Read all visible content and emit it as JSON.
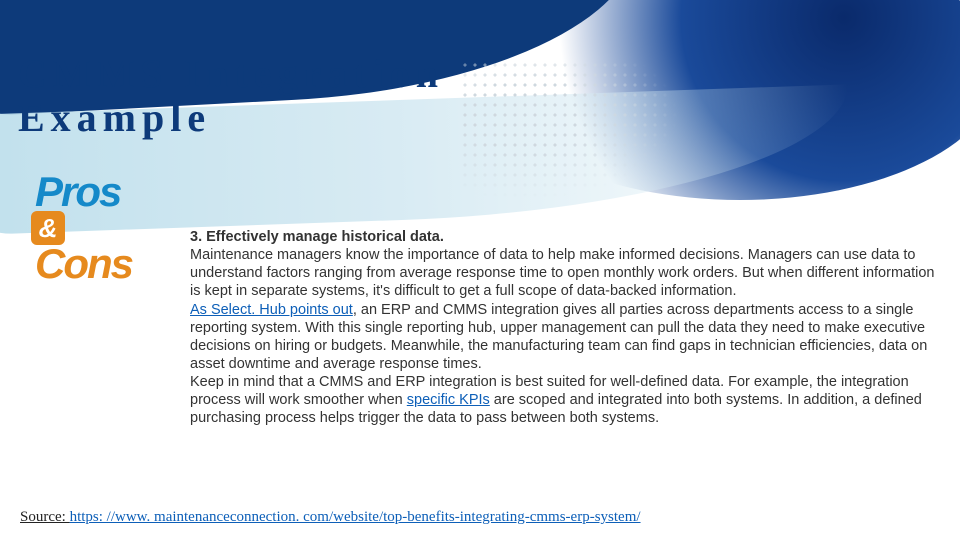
{
  "title": "CMMS Integration\nExample",
  "proscons": {
    "pros": "Pros",
    "and": "&",
    "cons": "Cons"
  },
  "item": {
    "heading": "3. Effectively manage historical data.",
    "para1": "Maintenance managers know the importance of data to help make informed decisions. Managers can use data to understand factors ranging from average response time to open monthly work orders. But when different information is kept in separate systems, it's difficult to get a full scope of data-backed information.",
    "link1_text": "As Select. Hub points out",
    "para2_after_link": ", an ERP and CMMS integration gives all parties across departments access to a single reporting system. With this single reporting hub, upper management can pull the data they need to make executive decisions on hiring or budgets. Meanwhile, the manufacturing team can find gaps in technician efficiencies, data on asset downtime and average response times.",
    "para3_before_link": "Keep in mind that a CMMS and ERP integration is best suited for well-defined data. For example, the integration process will work smoother when ",
    "link2_text": "specific KPIs",
    "para3_after_link": " are scoped and integrated into both systems. In addition, a defined purchasing process helps trigger the data to pass between both systems."
  },
  "source": {
    "label": "Source: ",
    "url": "https: //www. maintenanceconnection. com/website/top-benefits-integrating-cmms-erp-system/"
  }
}
